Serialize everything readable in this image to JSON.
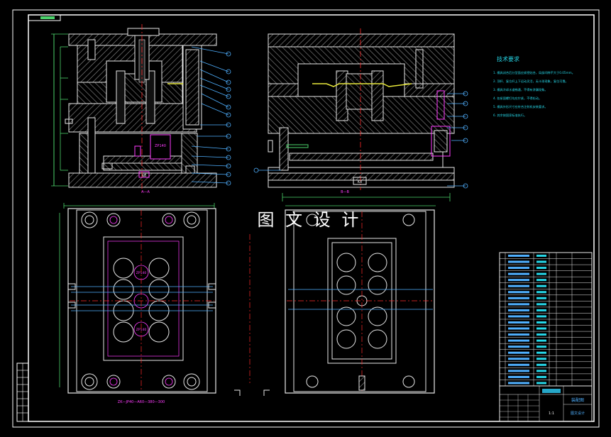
{
  "watermark": "图 文 设 计",
  "tech_requirements": {
    "title": "技术要求",
    "lines": [
      "1. 模具闭合后分型面应紧密贴合，局部间隙不大于0.05mm。",
      "2. 顶杆、复位杆上下运动灵活，无卡滞现象，复位可靠。",
      "3. 模具冷却水道畅通，不得有渗漏现象。",
      "4. 各紧固螺钉均应拧紧，不得松动。",
      "5. 模具外形尺寸应符合注射机安装要求。",
      "6. 其余按国家标准执行。"
    ]
  },
  "title_block": {
    "drawing_name": "装配图",
    "company": "图文设计",
    "scale": "1:1"
  },
  "views": {
    "section_a": {
      "caption": "A—A"
    },
    "section_b": {
      "caption": "B—B"
    },
    "top_view": {
      "caption": "ZK—JP40—A60—380—300"
    }
  },
  "colors": {
    "background": "#000000",
    "frame": "#ffffff",
    "mold": "#e8e8e8",
    "hatch": "#9a9a9a",
    "dimension": "#4bd36b",
    "leader": "#4fb0ff",
    "text": "#26d7e8",
    "magenta": "#ff3cff",
    "centerline": "#ff2a2a",
    "yellow": "#e8e83a"
  }
}
